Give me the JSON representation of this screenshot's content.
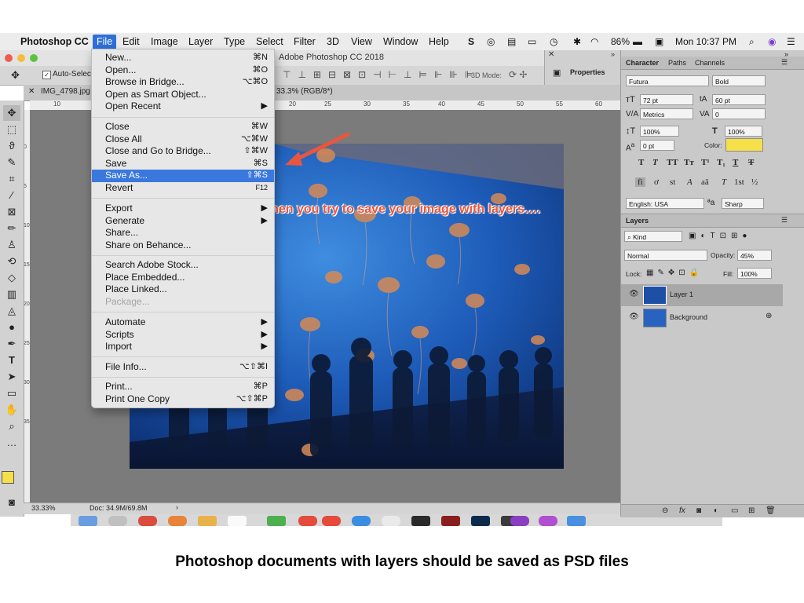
{
  "menubar": {
    "app_name": "Photoshop CC",
    "menus": [
      "File",
      "Edit",
      "Image",
      "Layer",
      "Type",
      "Select",
      "Filter",
      "3D",
      "View",
      "Window",
      "Help"
    ],
    "battery": "86%",
    "clock": "Mon 10:37 PM"
  },
  "window": {
    "title": "Adobe Photoshop CC 2018",
    "doc_tab_name": "IMG_4798.jpg",
    "doc_tab_info": "33.3% (RGB/8*)",
    "auto_select_label": "Auto-Select",
    "mode_3d_label": "3D Mode:",
    "properties_label": "Properties"
  },
  "ruler": {
    "top_ticks": [
      "10",
      "20",
      "25",
      "30",
      "35",
      "40",
      "45",
      "50",
      "55",
      "60"
    ],
    "left_ticks": [
      "0",
      "5",
      "10",
      "15",
      "20",
      "25",
      "30",
      "35"
    ]
  },
  "file_menu": {
    "items": [
      {
        "label": "New...",
        "shortcut": "⌘N"
      },
      {
        "label": "Open...",
        "shortcut": "⌘O"
      },
      {
        "label": "Browse in Bridge...",
        "shortcut": "⌥⌘O"
      },
      {
        "label": "Open as Smart Object...",
        "shortcut": ""
      },
      {
        "label": "Open Recent",
        "shortcut": "▶"
      },
      {
        "label": "Close",
        "shortcut": "⌘W"
      },
      {
        "label": "Close All",
        "shortcut": "⌥⌘W"
      },
      {
        "label": "Close and Go to Bridge...",
        "shortcut": "⇧⌘W"
      },
      {
        "label": "Save",
        "shortcut": "⌘S"
      },
      {
        "label": "Save As...",
        "shortcut": "⇧⌘S"
      },
      {
        "label": "Revert",
        "shortcut": "F12"
      },
      {
        "label": "Export",
        "shortcut": "▶"
      },
      {
        "label": "Generate",
        "shortcut": "▶"
      },
      {
        "label": "Share...",
        "shortcut": ""
      },
      {
        "label": "Share on Behance...",
        "shortcut": ""
      },
      {
        "label": "Search Adobe Stock...",
        "shortcut": ""
      },
      {
        "label": "Place Embedded...",
        "shortcut": ""
      },
      {
        "label": "Place Linked...",
        "shortcut": ""
      },
      {
        "label": "Package...",
        "shortcut": ""
      },
      {
        "label": "Automate",
        "shortcut": "▶"
      },
      {
        "label": "Scripts",
        "shortcut": "▶"
      },
      {
        "label": "Import",
        "shortcut": "▶"
      },
      {
        "label": "File Info...",
        "shortcut": "⌥⇧⌘I"
      },
      {
        "label": "Print...",
        "shortcut": "⌘P"
      },
      {
        "label": "Print One Copy",
        "shortcut": "⌥⇧⌘P"
      }
    ],
    "highlighted": "Save As...",
    "disabled": [
      "Package..."
    ]
  },
  "character_panel": {
    "tabs": [
      "Character",
      "Paths",
      "Channels"
    ],
    "font_family": "Futura",
    "font_style": "Bold",
    "font_size": "72 pt",
    "leading": "60 pt",
    "kerning": "Metrics",
    "tracking": "0",
    "vertical_scale": "100%",
    "horizontal_scale": "100%",
    "baseline_shift": "0 pt",
    "color_label": "Color:",
    "text_color": "#f5e04a",
    "language": "English: USA",
    "aa_glyph": "ªa",
    "antialias": "Sharp",
    "style_buttons": [
      "T",
      "T",
      "TT",
      "Tт",
      "T¹",
      "T₁",
      "T",
      "T"
    ],
    "opentype_buttons": [
      "fi",
      "ơ",
      "st",
      "A",
      "aā",
      "T",
      "1st",
      "½"
    ]
  },
  "layers_panel": {
    "title": "Layers",
    "kind_label": "Kind",
    "blend_mode": "Normal",
    "opacity_label": "Opacity:",
    "opacity": "45%",
    "lock_label": "Lock:",
    "fill_label": "Fill:",
    "fill": "100%",
    "layers": [
      {
        "name": "Layer 1"
      },
      {
        "name": "Background"
      }
    ],
    "footer_icons": [
      "link-icon",
      "fx-icon",
      "mask-icon",
      "adjustment-icon",
      "group-icon",
      "new-layer-icon",
      "trash-icon"
    ]
  },
  "status": {
    "zoom": "33.33%",
    "doc_size": "Doc: 34.9M/69.8M"
  },
  "annotation": "When you try to save your image with layers….",
  "caption": "Photoshop documents with layers should be saved as PSD files"
}
